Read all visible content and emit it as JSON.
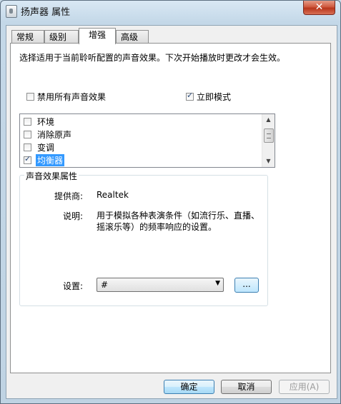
{
  "window": {
    "title": "扬声器 属性",
    "close_label": "✕"
  },
  "tabs": [
    {
      "label": "常规"
    },
    {
      "label": "级别"
    },
    {
      "label": "增强"
    },
    {
      "label": "高级"
    }
  ],
  "active_tab": "增强",
  "enhancements": {
    "intro": "选择适用于当前聆听配置的声音效果。下次开始播放时更改才会生效。",
    "disable_all_label": "禁用所有声音效果",
    "disable_all_checked": false,
    "immediate_mode_label": "立即模式",
    "immediate_mode_checked": true,
    "items": [
      {
        "label": "环境",
        "checked": false
      },
      {
        "label": "消除原声",
        "checked": false
      },
      {
        "label": "变调",
        "checked": false
      },
      {
        "label": "均衡器",
        "checked": true
      }
    ],
    "selected_item": "均衡器"
  },
  "properties": {
    "group_title": "声音效果属性",
    "provider_label": "提供商:",
    "provider_value": "Realtek",
    "description_label": "说明:",
    "description_value": "用于模拟各种表演条件（如流行乐、直播、摇滚乐等）的频率响应的设置。",
    "setting_label": "设置:",
    "setting_value": "#",
    "more_button_label": "..."
  },
  "footer": {
    "ok_label": "确定",
    "cancel_label": "取消",
    "apply_label": "应用(A)"
  },
  "colors": {
    "selection": "#3399ff",
    "close_button": "#c8462b"
  }
}
